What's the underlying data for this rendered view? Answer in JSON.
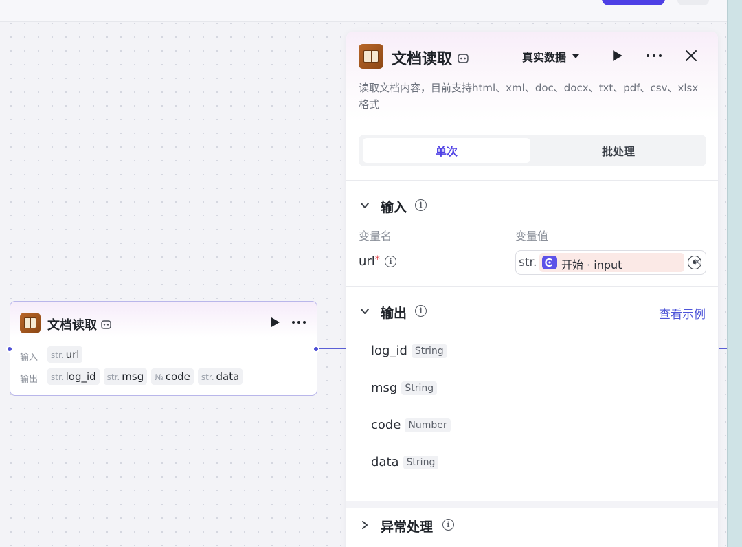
{
  "node": {
    "title": "文档读取",
    "input_label": "输入",
    "output_label": "输出",
    "inputs": [
      {
        "type": "str.",
        "name": "url"
      }
    ],
    "outputs": [
      {
        "type": "str.",
        "name": "log_id"
      },
      {
        "type": "str.",
        "name": "msg"
      },
      {
        "type": "№",
        "name": "code"
      },
      {
        "type": "str.",
        "name": "data"
      }
    ]
  },
  "panel": {
    "title": "文档读取",
    "mode": "真实数据",
    "description": "读取文档内容，目前支持html、xml、doc、docx、txt、pdf、csv、xlsx格式",
    "tabs": [
      {
        "label": "单次",
        "active": true
      },
      {
        "label": "批处理",
        "active": false
      }
    ],
    "input_section": {
      "title": "输入",
      "col_name": "变量名",
      "col_value": "变量值",
      "var_name": "url",
      "required_mark": "*",
      "value_type": "str.",
      "ref_node": "开始",
      "ref_sep": "·",
      "ref_var": "input"
    },
    "output_section": {
      "title": "输出",
      "example_link": "查看示例",
      "items": [
        {
          "name": "log_id",
          "type": "String"
        },
        {
          "name": "msg",
          "type": "String"
        },
        {
          "name": "code",
          "type": "Number"
        },
        {
          "name": "data",
          "type": "String"
        }
      ]
    },
    "error_section": {
      "title": "异常处理"
    }
  },
  "colors": {
    "accent": "#4e40e5",
    "link": "#4e55d8",
    "node_border": "#b9b6ea",
    "edge": "#5b5fd6"
  }
}
